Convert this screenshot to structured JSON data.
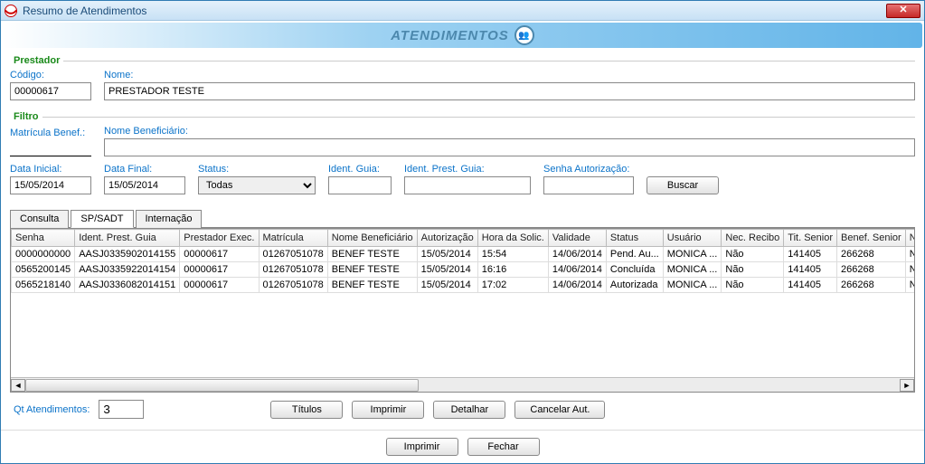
{
  "window": {
    "title": "Resumo de Atendimentos"
  },
  "banner": {
    "text": "ATENDIMENTOS"
  },
  "prestador": {
    "legend": "Prestador",
    "codigo_label": "Código:",
    "codigo_value": "00000617",
    "nome_label": "Nome:",
    "nome_value": "PRESTADOR TESTE"
  },
  "filtro": {
    "legend": "Filtro",
    "matricula_label": "Matrícula Benef.:",
    "matricula_value": "",
    "nomebenef_label": "Nome Beneficiário:",
    "nomebenef_value": "",
    "dataini_label": "Data Inicial:",
    "dataini_value": "15/05/2014",
    "datafim_label": "Data Final:",
    "datafim_value": "15/05/2014",
    "status_label": "Status:",
    "status_value": "Todas",
    "identguia_label": "Ident. Guia:",
    "identguia_value": "",
    "identprestguia_label": "Ident. Prest. Guia:",
    "identprestguia_value": "",
    "senha_label": "Senha Autorização:",
    "senha_value": "",
    "buscar": "Buscar"
  },
  "tabs": {
    "consulta": "Consulta",
    "spsadt": "SP/SADT",
    "internacao": "Internação"
  },
  "columns": [
    "Senha",
    "Ident. Prest. Guia",
    "Prestador Exec.",
    "Matrícula",
    "Nome Beneficiário",
    "Autorização",
    "Hora da Solic.",
    "Validade",
    "Status",
    "Usuário",
    "Nec. Recibo",
    "Tit. Senior",
    "Benef. Senior",
    "Negociação"
  ],
  "rows": [
    [
      "0000000000",
      "AASJ0335902014155",
      "00000617",
      "01267051078",
      "BENEF TESTE",
      "15/05/2014",
      "15:54",
      "14/06/2014",
      "Pend. Au...",
      "MONICA ...",
      "Não",
      "141405",
      "266268",
      "Não"
    ],
    [
      "0565200145",
      "AASJ0335922014154",
      "00000617",
      "01267051078",
      "BENEF TESTE",
      "15/05/2014",
      "16:16",
      "14/06/2014",
      "Concluída",
      "MONICA ...",
      "Não",
      "141405",
      "266268",
      "Não"
    ],
    [
      "0565218140",
      "AASJ0336082014151",
      "00000617",
      "01267051078",
      "BENEF TESTE",
      "15/05/2014",
      "17:02",
      "14/06/2014",
      "Autorizada",
      "MONICA ...",
      "Não",
      "141405",
      "266268",
      "Não"
    ]
  ],
  "gridfoot": {
    "qt_label": "Qt Atendimentos:",
    "qt_value": "3",
    "titulos": "Títulos",
    "imprimir": "Imprimir",
    "detalhar": "Detalhar",
    "cancelar": "Cancelar Aut."
  },
  "bottom": {
    "imprimir": "Imprimir",
    "fechar": "Fechar"
  }
}
